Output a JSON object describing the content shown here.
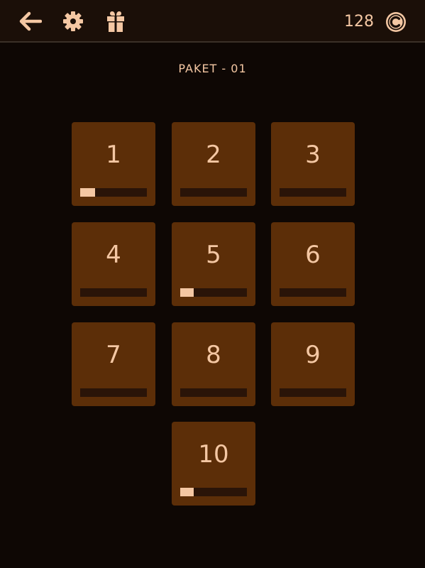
{
  "header": {
    "back_icon": "arrow-left-icon",
    "settings_icon": "gear-icon",
    "gift_icon": "gift-icon",
    "coins": "128",
    "coin_icon": "coin-c-icon"
  },
  "pack": {
    "title": "PAKET - 01"
  },
  "colors": {
    "background": "#0e0704",
    "topbar": "#1b0f08",
    "tile": "#5c2e08",
    "track": "#2a1408",
    "accent": "#f4c7a3"
  },
  "levels": [
    {
      "label": "1",
      "progress": 0.22
    },
    {
      "label": "2",
      "progress": 0
    },
    {
      "label": "3",
      "progress": 0
    },
    {
      "label": "4",
      "progress": 0
    },
    {
      "label": "5",
      "progress": 0.2
    },
    {
      "label": "6",
      "progress": 0
    },
    {
      "label": "7",
      "progress": 0
    },
    {
      "label": "8",
      "progress": 0
    },
    {
      "label": "9",
      "progress": 0
    },
    {
      "label": "10",
      "progress": 0.2
    }
  ]
}
